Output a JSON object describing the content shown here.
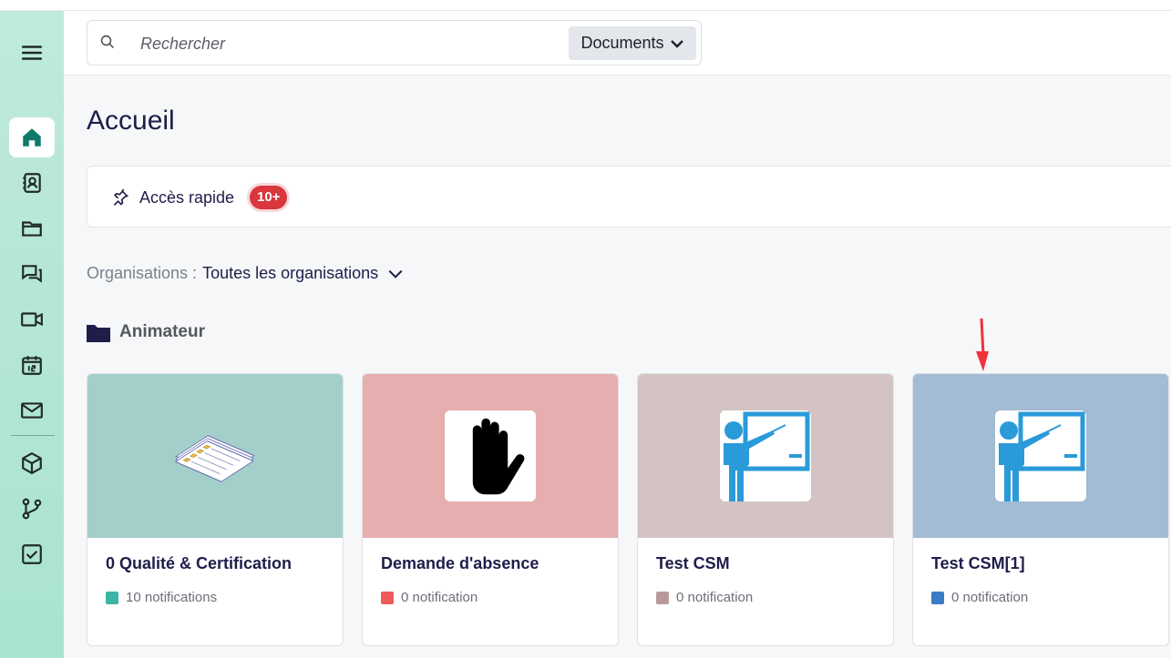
{
  "search": {
    "placeholder": "Rechercher",
    "scope_label": "Documents"
  },
  "page": {
    "title": "Accueil"
  },
  "quick_access": {
    "label": "Accès rapide",
    "badge": "10+"
  },
  "organisations": {
    "label": "Organisations :",
    "value": "Toutes les organisations"
  },
  "section": {
    "title": "Animateur"
  },
  "sidebar": {
    "items": [
      {
        "icon": "menu-icon"
      },
      {
        "icon": "home-icon",
        "active": true
      },
      {
        "icon": "contacts-icon"
      },
      {
        "icon": "folder-icon"
      },
      {
        "icon": "chat-icon"
      },
      {
        "icon": "video-icon"
      },
      {
        "icon": "calendar-icon"
      },
      {
        "icon": "mail-icon"
      },
      {
        "icon": "cube-icon"
      },
      {
        "icon": "workflow-icon"
      },
      {
        "icon": "task-checkbox-icon"
      }
    ]
  },
  "cards": [
    {
      "title": "0 Qualité & Certification",
      "notifications": "10 notifications",
      "banner_color": "#a3cfcb",
      "dot_color": "#3bb5a6",
      "icon": "documents-checklist-icon"
    },
    {
      "title": "Demande d'absence",
      "notifications": "0 notification",
      "banner_color": "#e6aeae",
      "dot_color": "#ef5b5b",
      "icon": "hand-stop-icon"
    },
    {
      "title": "Test CSM",
      "notifications": "0 notification",
      "banner_color": "#d3c3c3",
      "dot_color": "#b99a9a",
      "icon": "presenter-board-icon"
    },
    {
      "title": "Test CSM[1]",
      "notifications": "0 notification",
      "banner_color": "#a3bbd3",
      "dot_color": "#3a7cc4",
      "icon": "presenter-board-icon"
    }
  ],
  "colors": {
    "accent": "#1f1d4a",
    "sidebar": "#b4e6d4",
    "badge": "#d9363e",
    "active_icon": "#0f7a6c"
  }
}
